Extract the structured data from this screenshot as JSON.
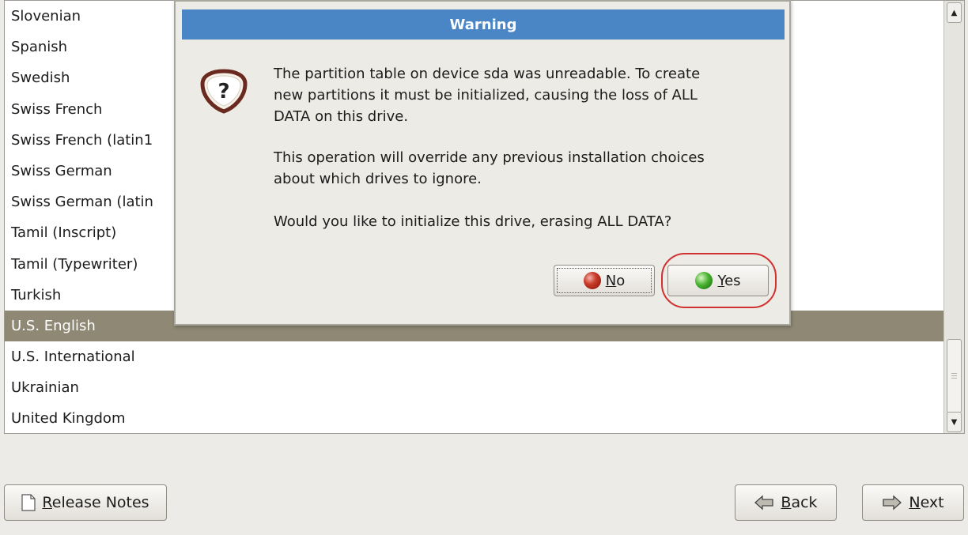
{
  "keyboard_list": {
    "items": [
      "Slovenian",
      "Spanish",
      "Swedish",
      "Swiss French",
      "Swiss French (latin1",
      "Swiss German",
      "Swiss German (latin",
      "Tamil (Inscript)",
      "Tamil (Typewriter)",
      "Turkish",
      "U.S. English",
      "U.S. International",
      "Ukrainian",
      "United Kingdom"
    ],
    "selected": "U.S. English"
  },
  "dialog": {
    "title": "Warning",
    "icon": "question-icon",
    "message_1_line1": "The partition table on device sda was unreadable. To create",
    "message_1_line2": "new partitions it must be initialized, causing the loss of ALL",
    "message_1_line3": "DATA on this drive.",
    "message_2_line1": "This operation will override any previous installation choices",
    "message_2_line2": "about which drives to ignore.",
    "message_3": "Would you like to initialize this drive, erasing ALL DATA?",
    "no_button": {
      "mnemonic": "N",
      "rest": "o",
      "icon": "red-ball-icon"
    },
    "yes_button": {
      "mnemonic": "Y",
      "rest": "es",
      "icon": "green-ball-icon"
    },
    "highlight_color": "#d23131"
  },
  "footer": {
    "release_notes": {
      "mnemonic": "R",
      "rest": "elease Notes",
      "icon": "document-icon"
    },
    "back": {
      "mnemonic": "B",
      "rest": "ack",
      "icon": "back-arrow-icon"
    },
    "next": {
      "mnemonic": "N",
      "rest": "ext",
      "icon": "next-arrow-icon"
    }
  },
  "colors": {
    "selection": "#8f8874",
    "titlebar": "#4a86c6",
    "background": "#edebe7"
  }
}
